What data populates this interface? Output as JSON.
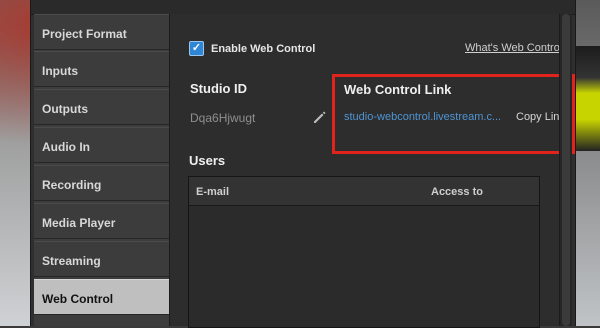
{
  "sidebar": {
    "items": [
      {
        "label": "Project Format"
      },
      {
        "label": "Inputs"
      },
      {
        "label": "Outputs"
      },
      {
        "label": "Audio In"
      },
      {
        "label": "Recording"
      },
      {
        "label": "Media Player"
      },
      {
        "label": "Streaming"
      },
      {
        "label": "Web Control",
        "active": true
      }
    ]
  },
  "main": {
    "enable_checkbox": {
      "label": "Enable Web Control",
      "checked": true
    },
    "whats_link": "What's Web Control?",
    "studio_id": {
      "title": "Studio ID",
      "value": "Dqa6Hjwugt"
    },
    "web_control_link": {
      "title": "Web Control Link",
      "url": "studio-webcontrol.livestream.c...",
      "copy_label": "Copy Link"
    },
    "users": {
      "title": "Users",
      "columns": [
        "E-mail",
        "Access to"
      ],
      "rows": []
    }
  },
  "colors": {
    "highlight_border": "#e0241b",
    "link": "#4f94d3",
    "checkbox": "#2f86d6",
    "active_nav": "#bfbfbf"
  },
  "icons": {
    "edit": "pencil-icon",
    "check": "checkmark-icon"
  }
}
